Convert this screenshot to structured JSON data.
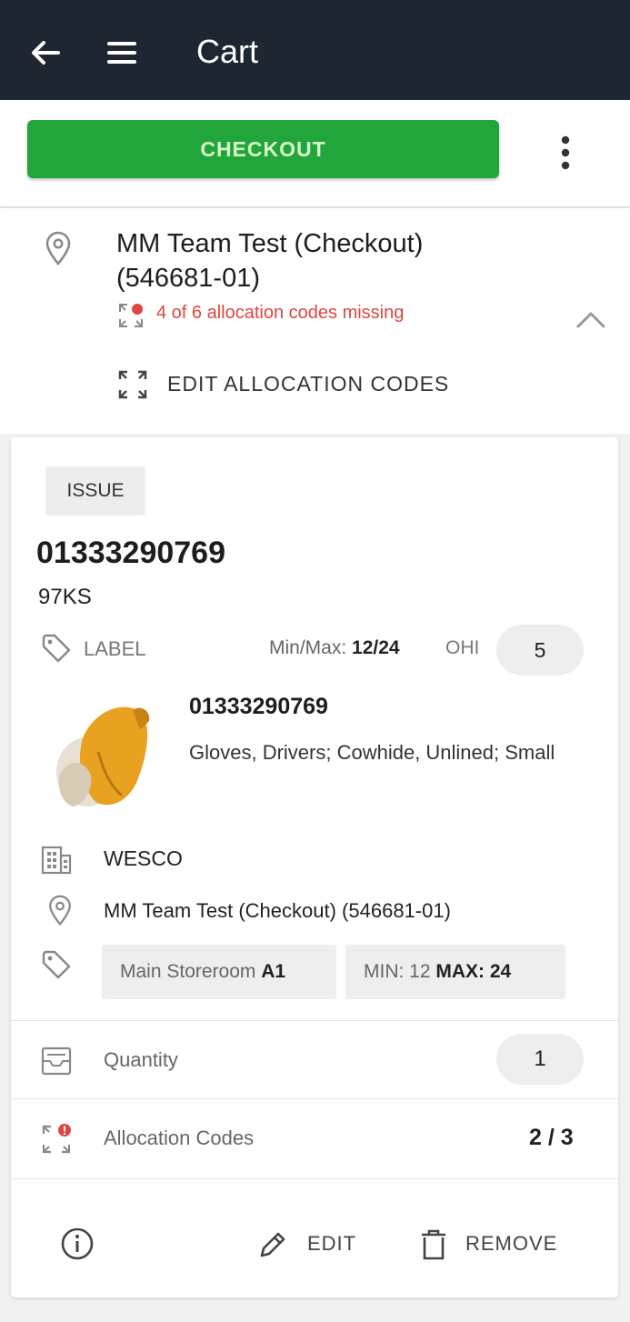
{
  "header": {
    "title": "Cart"
  },
  "toolbar": {
    "checkout_label": "CHECKOUT"
  },
  "location": {
    "name": "MM Team Test (Checkout) (546681-01)",
    "missing_text": "4 of 6 allocation codes missing",
    "edit_allocation_label": "EDIT ALLOCATION CODES"
  },
  "item": {
    "badge": "ISSUE",
    "sku": "01333290769",
    "sub_code": "97KS",
    "label_text": "LABEL",
    "minmax_label": "Min/Max:",
    "minmax_value": "12/24",
    "ohi_label": "OHI",
    "ohi_value": "5",
    "product": {
      "sku": "01333290769",
      "description": "Gloves, Drivers; Cowhide, Unlined; Small"
    },
    "supplier": "WESCO",
    "location": "MM Team Test (Checkout) (546681-01)",
    "bin": {
      "storeroom": "Main Storeroom",
      "code": "A1"
    },
    "minmax_chip": {
      "min_label": "MIN: 12",
      "max_label": "MAX: 24"
    },
    "quantity_label": "Quantity",
    "quantity_value": "1",
    "allocation_label": "Allocation Codes",
    "allocation_value": "2 / 3"
  },
  "actions": {
    "edit_label": "EDIT",
    "remove_label": "REMOVE"
  },
  "colors": {
    "appbar": "#1e2631",
    "checkout_green": "#22a63b",
    "warning_red": "#e0453f"
  },
  "icons": {
    "back": "arrow-left-icon",
    "menu": "hamburger-menu-icon",
    "more": "more-vertical-icon",
    "pin": "map-pin-icon",
    "warning": "allocation-warning-icon",
    "collapse": "chevron-up-icon",
    "expand": "expand-arrows-icon",
    "tag": "tag-icon",
    "building": "building-icon",
    "quantity": "inbox-stack-icon",
    "info": "info-circle-icon",
    "edit": "pencil-icon",
    "remove": "trash-icon"
  }
}
